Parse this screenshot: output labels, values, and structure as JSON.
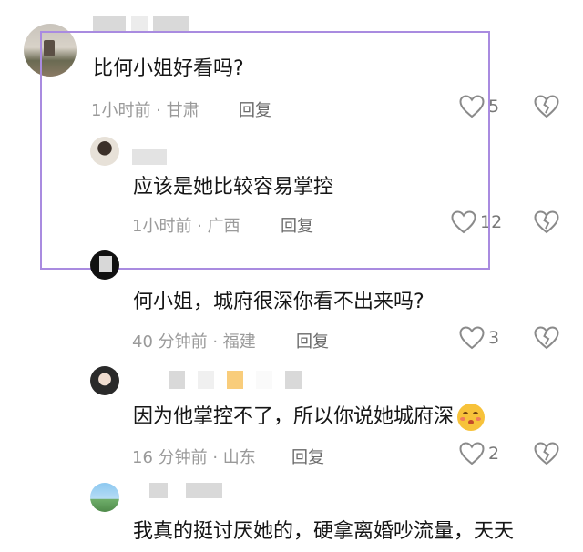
{
  "comments": [
    {
      "text": "比何小姐好看吗?",
      "meta": "1小时前 · 甘肃",
      "reply": "回复",
      "likes": "5"
    },
    {
      "text": "应该是她比较容易掌控",
      "meta": "1小时前 · 广西",
      "reply": "回复",
      "likes": "12"
    },
    {
      "text": "何小姐，城府很深你看不出来吗?",
      "meta": "40 分钟前 · 福建",
      "reply": "回复",
      "likes": "3"
    },
    {
      "text": "因为他掌控不了，所以你说她城府深",
      "meta": "16 分钟前 · 山东",
      "reply": "回复",
      "likes": "2"
    },
    {
      "text": "我真的挺讨厌她的，硬拿离婚吵流量，天天"
    }
  ],
  "colors": {
    "highlight_border": "#a98be0",
    "meta_text": "#9a9a9a",
    "redacted_block": "#d9d9d9",
    "accent_block": "#f9cd7b"
  },
  "icons": [
    "heart-icon",
    "broken-heart-icon",
    "blushing-emoji-icon"
  ]
}
